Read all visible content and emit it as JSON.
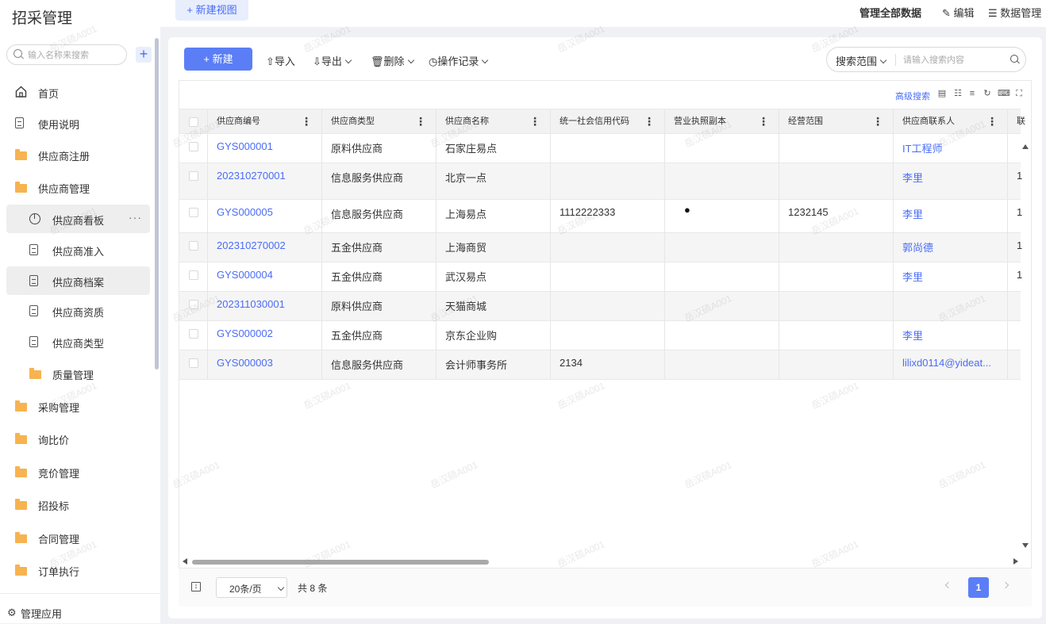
{
  "sidebar": {
    "title": "招采管理",
    "search_placeholder": "输入名称来搜索",
    "add_label": "+",
    "items": [
      {
        "label": "首页",
        "icon": "home-icon"
      },
      {
        "label": "使用说明",
        "icon": "document-icon"
      },
      {
        "label": "供应商注册",
        "icon": "folder-icon"
      },
      {
        "label": "供应商管理",
        "icon": "folder-open-icon"
      },
      {
        "label": "供应商看板",
        "icon": "pie-chart-icon"
      },
      {
        "label": "供应商准入",
        "icon": "document-icon"
      },
      {
        "label": "供应商档案",
        "icon": "document-icon"
      },
      {
        "label": "供应商资质",
        "icon": "document-icon"
      },
      {
        "label": "供应商类型",
        "icon": "document-icon"
      },
      {
        "label": "质量管理",
        "icon": "folder-icon"
      },
      {
        "label": "采购管理",
        "icon": "folder-icon"
      },
      {
        "label": "询比价",
        "icon": "folder-icon"
      },
      {
        "label": "竞价管理",
        "icon": "folder-icon"
      },
      {
        "label": "招投标",
        "icon": "folder-icon"
      },
      {
        "label": "合同管理",
        "icon": "folder-icon"
      },
      {
        "label": "订单执行",
        "icon": "folder-icon"
      }
    ],
    "more_label": "···",
    "manage_app": "管理应用"
  },
  "topbar": {
    "new_view": "+ 新建视图",
    "all_data": "管理全部数据",
    "edit": "编辑",
    "data_manage": "数据管理"
  },
  "toolbar": {
    "new": "+ 新建",
    "import": "导入",
    "export": "导出",
    "delete": "删除",
    "log": "操作记录",
    "search_scope": "搜索范围",
    "search_placeholder": "请输入搜索内容",
    "advanced_search": "高级搜索"
  },
  "table": {
    "columns": [
      "供应商编号",
      "供应商类型",
      "供应商名称",
      "统一社会信用代码",
      "营业执照副本",
      "经营范围",
      "供应商联系人",
      "联"
    ],
    "rows": [
      {
        "id": "GYS000001",
        "type": "原料供应商",
        "name": "石家庄易点",
        "code": "",
        "license": "",
        "scope": "",
        "contact": "IT工程师",
        "extra": ""
      },
      {
        "id": "202310270001",
        "type": "信息服务供应商",
        "name": "北京一点",
        "code": "",
        "license": "",
        "scope": "",
        "contact": "李里",
        "extra": "1"
      },
      {
        "id": "GYS000005",
        "type": "信息服务供应商",
        "name": "上海易点",
        "code": "1112222333",
        "license": "",
        "scope": "1232145",
        "contact": "李里",
        "extra": "1"
      },
      {
        "id": "202310270002",
        "type": "五金供应商",
        "name": "上海商贸",
        "code": "",
        "license": "",
        "scope": "",
        "contact": "郭尚德",
        "extra": "1"
      },
      {
        "id": "GYS000004",
        "type": "五金供应商",
        "name": "武汉易点",
        "code": "",
        "license": "",
        "scope": "",
        "contact": "李里",
        "extra": "1"
      },
      {
        "id": "202311030001",
        "type": "原料供应商",
        "name": "天猫商城",
        "code": "",
        "license": "",
        "scope": "",
        "contact": "",
        "extra": ""
      },
      {
        "id": "GYS000002",
        "type": "五金供应商",
        "name": "京东企业购",
        "code": "",
        "license": "",
        "scope": "",
        "contact": "李里",
        "extra": ""
      },
      {
        "id": "GYS000003",
        "type": "信息服务供应商",
        "name": "会计师事务所",
        "code": "2134",
        "license": "",
        "scope": "",
        "contact": "lilixd0114@yideat...",
        "extra": ""
      }
    ]
  },
  "footer": {
    "page_size": "20条/页",
    "total": "共 8 条",
    "current_page": "1"
  },
  "watermark": "岳汉硕A001",
  "colors": {
    "accent": "#5b7ef7",
    "link": "#4a6cf7",
    "folder": "#f7b350"
  }
}
